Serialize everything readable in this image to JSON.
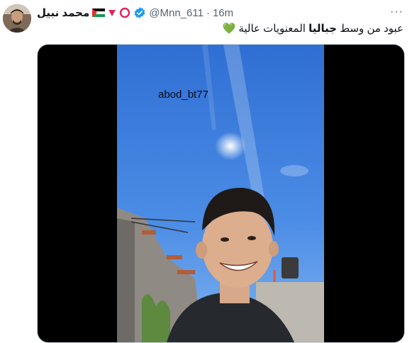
{
  "post": {
    "author_name": "محمد نبيل",
    "handle": "@Mnn_611",
    "separator": "·",
    "time": "16m",
    "text_part1": "عبود من وسط ",
    "text_bold": "جباليا",
    "text_part2": "  المعنويات عالية ",
    "emoji": "💚",
    "more_label": "···"
  },
  "media": {
    "watermark": "abod_bt77"
  },
  "icons": [
    "avatar",
    "palestine-flag-icon",
    "red-triangle-icon",
    "red-circle-icon",
    "verified-badge-icon",
    "more-icon"
  ],
  "colors": {
    "verified": "#1d9bf0",
    "red": "#e0245e",
    "secondary_text": "#536471"
  }
}
